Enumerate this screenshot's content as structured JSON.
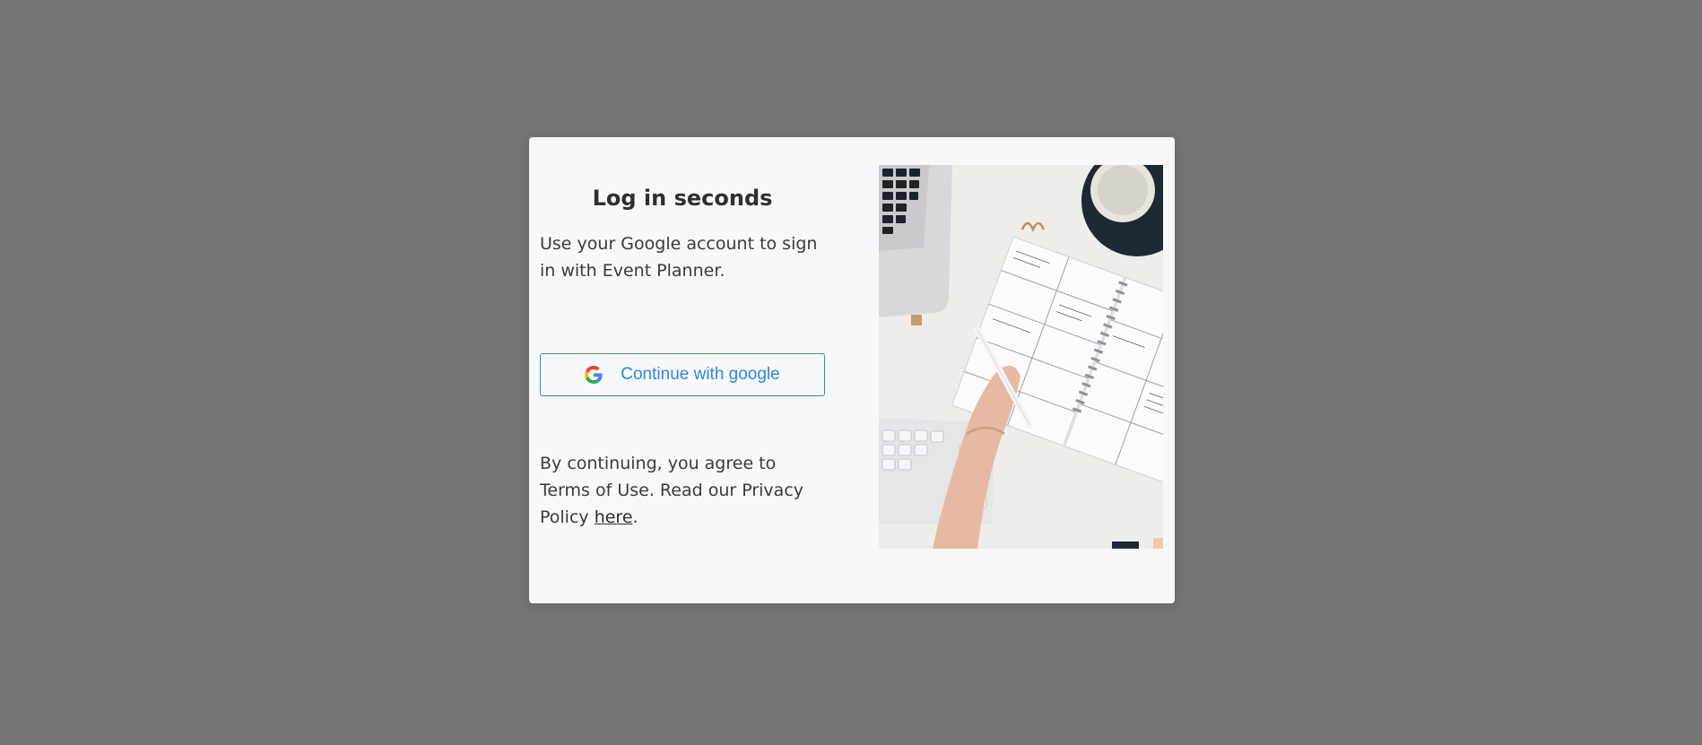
{
  "modal": {
    "title": "Log in seconds",
    "subtitle": "Use your Google account to sign in with Event Planner.",
    "google_button": {
      "label": "Continue with google",
      "icon": "google-icon"
    },
    "terms_text": "By continuing, you agree to Terms of Use. Read our Privacy Policy ",
    "terms_link": "here",
    "terms_end": "."
  },
  "colors": {
    "backdrop": "#757575",
    "modal_bg": "#f6f8fa",
    "accent": "#2f86e0"
  }
}
